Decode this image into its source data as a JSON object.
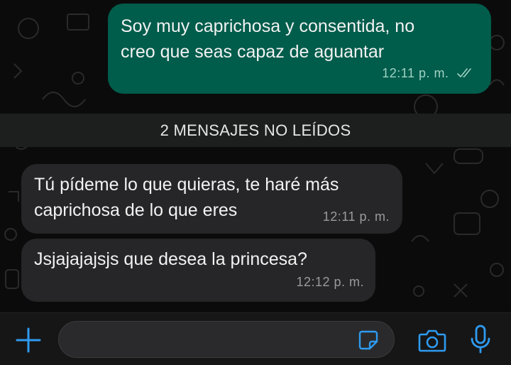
{
  "chat": {
    "messages": [
      {
        "direction": "outgoing",
        "lines": [
          "Soy muy caprichosa y consentida, no",
          "creo que seas capaz de aguantar"
        ],
        "time": "12:11 p. m.",
        "status_icon": "double-check-icon"
      },
      {
        "direction": "incoming",
        "lines": [
          "Tú pídeme lo que quieras, te haré más",
          "caprichosa de lo que eres"
        ],
        "time": "12:11 p. m."
      },
      {
        "direction": "incoming",
        "lines": [
          "Jsjajajajsjs que desea la princesa?"
        ],
        "time": "12:12 p. m."
      }
    ],
    "unread_banner": "2 MENSAJES NO LEÍDOS"
  },
  "composer": {
    "input_value": "",
    "icons": [
      "plus-icon",
      "sticker-icon",
      "camera-icon",
      "microphone-icon"
    ]
  },
  "colors": {
    "outgoing_bubble": "#005c4b",
    "incoming_bubble": "#262628",
    "accent": "#2e9bf0",
    "background": "#0b0b0b"
  }
}
